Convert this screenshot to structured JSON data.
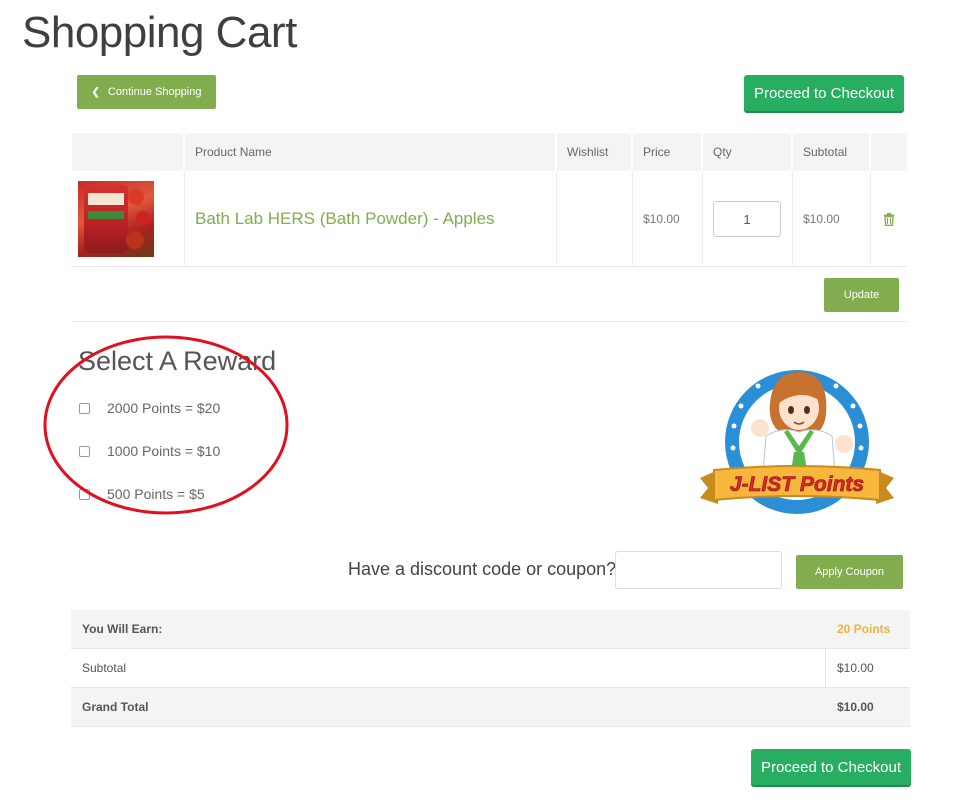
{
  "page": {
    "title": "Shopping Cart"
  },
  "nav": {
    "continue_label": "Continue Shopping",
    "checkout_label": "Proceed to Checkout"
  },
  "cart": {
    "headers": {
      "product": "Product Name",
      "wishlist": "Wishlist",
      "price": "Price",
      "qty": "Qty",
      "subtotal": "Subtotal"
    },
    "items": [
      {
        "name": "Bath Lab HERS (Bath Powder) - Apples",
        "price": "$10.00",
        "qty": "1",
        "subtotal": "$10.00"
      }
    ],
    "update_label": "Update"
  },
  "rewards": {
    "title": "Select A Reward",
    "options": [
      {
        "label": "2000 Points = $20"
      },
      {
        "label": "1000 Points = $10"
      },
      {
        "label": "500 Points = $5"
      }
    ],
    "logo_text": "J-LIST Points"
  },
  "coupon": {
    "label": "Have a discount code or coupon?",
    "placeholder": "",
    "apply_label": "Apply Coupon"
  },
  "totals": {
    "earn_label": "You Will Earn:",
    "earn_value": "20 Points",
    "subtotal_label": "Subtotal",
    "subtotal_value": "$10.00",
    "grand_label": "Grand Total",
    "grand_value": "$10.00"
  },
  "colors": {
    "olive": "#82ad4e",
    "green": "#27ae60",
    "points": "#f0b33a",
    "annotation": "#e0101e"
  }
}
